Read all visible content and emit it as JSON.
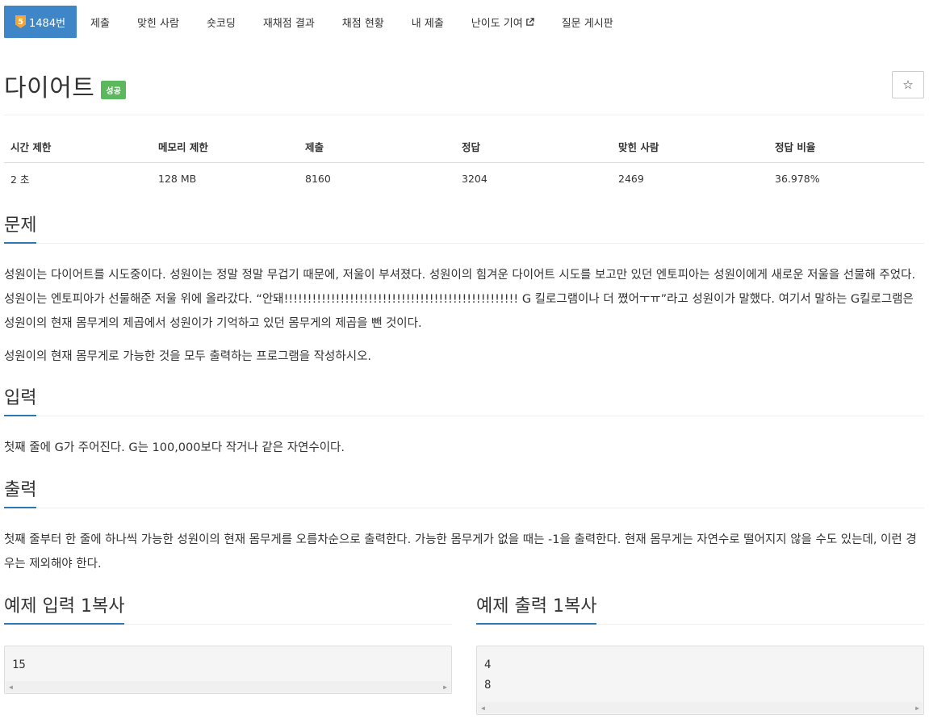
{
  "nav": {
    "tier": "5",
    "problem_number": "1484번",
    "items": [
      "제출",
      "맞힌 사람",
      "숏코딩",
      "재채점 결과",
      "채점 현황",
      "내 제출",
      "난이도 기여",
      "질문 게시판"
    ]
  },
  "title": "다이어트",
  "status_label": "성공",
  "star_icon": "☆",
  "info": {
    "headers": [
      "시간 제한",
      "메모리 제한",
      "제출",
      "정답",
      "맞힌 사람",
      "정답 비율"
    ],
    "values": [
      "2 초",
      "128 MB",
      "8160",
      "3204",
      "2469",
      "36.978%"
    ]
  },
  "sections": {
    "problem_title": "문제",
    "problem_p1": "성원이는 다이어트를 시도중이다. 성원이는 정말 정말 무겁기 때문에, 저울이 부셔졌다. 성원이의 힘겨운 다이어트 시도를 보고만 있던 엔토피아는 성원이에게 새로운 저울을 선물해 주었다. 성원이는 엔토피아가 선물해준 저울 위에 올라갔다. “안돼!!!!!!!!!!!!!!!!!!!!!!!!!!!!!!!!!!!!!!!!!!!!!!!!!! G 킬로그램이나 더 쪘어ㅜㅠ”라고 성원이가 말했다. 여기서 말하는 G킬로그램은 성원이의 현재 몸무게의 제곱에서 성원이가 기억하고 있던 몸무게의 제곱을 뺀 것이다.",
    "problem_p2": "성원이의 현재 몸무게로 가능한 것을 모두 출력하는 프로그램을 작성하시오.",
    "input_title": "입력",
    "input_p": "첫째 줄에 G가 주어진다. G는 100,000보다 작거나 같은 자연수이다.",
    "output_title": "출력",
    "output_p": "첫째 줄부터 한 줄에 하나씩 가능한 성원이의 현재 몸무게를 오름차순으로 출력한다. 가능한 몸무게가 없을 때는 -1을 출력한다. 현재 몸무게는 자연수로 떨어지지 않을 수도 있는데, 이런 경우는 제외해야 한다."
  },
  "examples": {
    "input_title": "예제 입력 1",
    "output_title": "예제 출력 1",
    "copy_label": "복사",
    "input_lines": [
      "15"
    ],
    "output_lines": [
      "4",
      "8"
    ]
  },
  "colors": {
    "nav_active": "#3f86c8",
    "success": "#5cb85c",
    "accent": "#2d78b3",
    "tier": "#f4a53a"
  }
}
